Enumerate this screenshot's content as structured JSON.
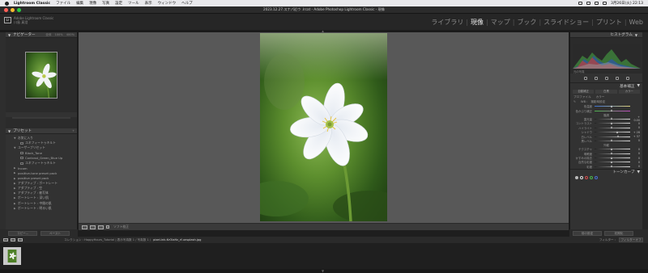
{
  "menubar": {
    "app_name": "Lightroom Classic",
    "items": [
      "ファイル",
      "編集",
      "現像",
      "写真",
      "設定",
      "ツール",
      "表示",
      "ウィンドウ",
      "ヘルプ"
    ],
    "clock": "3月26日(火) 22:13"
  },
  "window": {
    "title": "2023.12.27.スナパ近ウ .lrcat - Adobe Photoshop Lightroom Classic - 現像"
  },
  "identity": {
    "line1": "Adobe Lightroom Classic",
    "line2": "川島 真澄"
  },
  "modules": {
    "items": [
      "ライブラリ",
      "現像",
      "マップ",
      "ブック",
      "スライドショー",
      "プリント",
      "Web"
    ],
    "active": "現像"
  },
  "left_panel": {
    "navigator_label": "ナビゲーター",
    "navigator_options": [
      "全体",
      "100%",
      "400%"
    ],
    "presets_label": "プリセット",
    "presets": [
      {
        "text": "お気に入り",
        "level": 0,
        "toggle": "▼"
      },
      {
        "text": "ユネフィートゥキルト",
        "level": 1
      },
      {
        "text": "ユーザープリセット",
        "level": 0,
        "toggle": "▼"
      },
      {
        "text": "Black_Tone",
        "level": 1
      },
      {
        "text": "Contrast_Green_Blue Up",
        "level": 1
      },
      {
        "text": "ユネフィートゥキルト",
        "level": 1
      },
      {
        "text": "Incom",
        "level": 0,
        "toggle": "▶"
      },
      {
        "text": "positive-tone preset pack",
        "level": 0,
        "toggle": "▶"
      },
      {
        "text": "positive preset pack",
        "level": 0,
        "toggle": "▶"
      },
      {
        "text": "アダプティブ : ポートレート",
        "level": 0,
        "toggle": "▶"
      },
      {
        "text": "アダプティブ : 空",
        "level": 0,
        "toggle": "▶"
      },
      {
        "text": "アダプティブ : 被写体",
        "level": 0,
        "toggle": "▶"
      },
      {
        "text": "ポートレート : 深い肌",
        "level": 0,
        "toggle": "▶"
      },
      {
        "text": "ポートレート : 中間の肌",
        "level": 0,
        "toggle": "▶"
      },
      {
        "text": "ポートレート : 明るい肌",
        "level": 0,
        "toggle": "▶"
      }
    ],
    "copy_button": "コピー...",
    "paste_button": "ペースト"
  },
  "toolbar": {
    "soft_proof": "ソフト校正"
  },
  "right_panel": {
    "histogram_label": "ヒストグラム",
    "histogram_info": "元の写真",
    "basic_label": "基本補正",
    "tabs": [
      "自動補正",
      "白黒",
      "カラー"
    ],
    "profile_label": "プロファイル",
    "profile_value": "カラー",
    "wb_label": "WB :",
    "wb_value": "撮影時設定",
    "sliders": [
      {
        "label": "色温度",
        "value": "",
        "pos": 0.5
      },
      {
        "label": "色かぶり補正",
        "value": "",
        "pos": 0.5
      },
      {
        "label": "階調",
        "section": true
      },
      {
        "label": "露光量",
        "value": "+ 0.00",
        "pos": 0.5
      },
      {
        "label": "コントラスト",
        "value": "0",
        "pos": 0.5
      },
      {
        "label": "ハイライト",
        "value": "0",
        "pos": 0.5
      },
      {
        "label": "シャドウ",
        "value": "+ 28",
        "pos": 0.64
      },
      {
        "label": "白レベル",
        "value": "+ 37",
        "pos": 0.68
      },
      {
        "label": "黒レベル",
        "value": "0",
        "pos": 0.5
      },
      {
        "label": "外観",
        "section": true
      },
      {
        "label": "テクスチャ",
        "value": "0",
        "pos": 0.5
      },
      {
        "label": "明瞭度",
        "value": "0",
        "pos": 0.5
      },
      {
        "label": "かすみの除去",
        "value": "0",
        "pos": 0.5
      },
      {
        "label": "自然な彩度",
        "value": "0",
        "pos": 0.5
      },
      {
        "label": "彩度",
        "value": "0",
        "pos": 0.5
      }
    ],
    "tone_curve_label": "トーンカーブ",
    "prev_button": "前の設定",
    "reset_button": "初期化"
  },
  "filmstrip": {
    "path": "コレクション : HappyHours_Tutorial | 表示写真数 1 / 写真数 1 /",
    "filename": "pixel-ink-KrOlaHz_rf-unsplash.jpg",
    "filter_label": "フィルター :",
    "filter_value": "フィルターオフ"
  },
  "colors": {
    "accent": "#e6e6e6",
    "panel": "#323232",
    "canvas": "#585858"
  }
}
